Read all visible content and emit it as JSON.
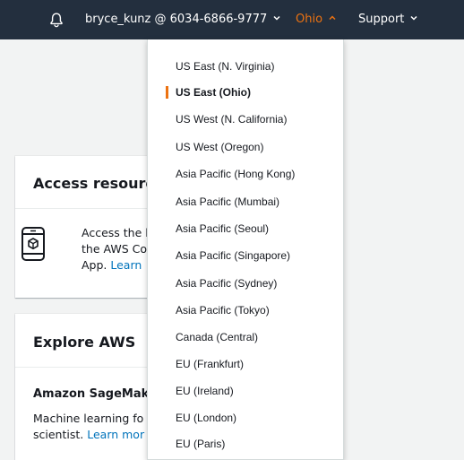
{
  "nav": {
    "account": "bryce_kunz @ 6034-6866-9777",
    "region": "Ohio",
    "support": "Support"
  },
  "colors": {
    "accent": "#ec7211",
    "nav_bg": "#232f3e",
    "link": "#0073bb"
  },
  "icons": [
    "bell-icon",
    "chevron-down-icon",
    "chevron-up-icon",
    "mobile-app-icon"
  ],
  "cards": {
    "access": {
      "title": "Access resource",
      "lines": [
        "Access the l",
        "the AWS Co",
        "App. "
      ],
      "link": "Learn"
    },
    "explore": {
      "title": "Explore AWS",
      "subtitle": "Amazon SageMak",
      "line1": "Machine learning fo",
      "line2": "scientist. ",
      "link": "Learn mor"
    }
  },
  "regions": {
    "selected": "US East (Ohio)",
    "items": [
      "US East (N. Virginia)",
      "US East (Ohio)",
      "US West (N. California)",
      "US West (Oregon)",
      "Asia Pacific (Hong Kong)",
      "Asia Pacific (Mumbai)",
      "Asia Pacific (Seoul)",
      "Asia Pacific (Singapore)",
      "Asia Pacific (Sydney)",
      "Asia Pacific (Tokyo)",
      "Canada (Central)",
      "EU (Frankfurt)",
      "EU (Ireland)",
      "EU (London)",
      "EU (Paris)"
    ]
  }
}
